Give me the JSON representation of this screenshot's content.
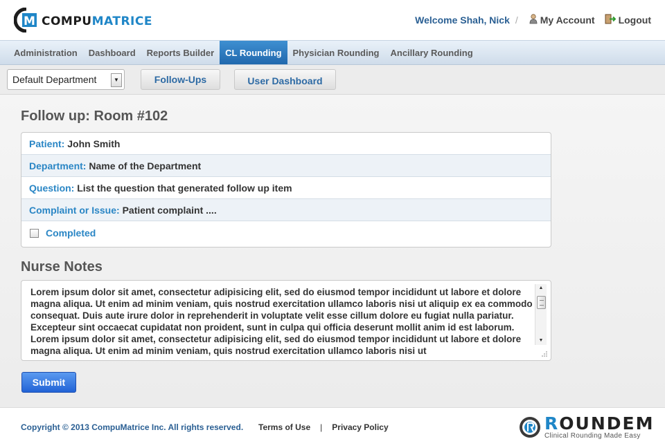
{
  "brand": {
    "name_part1": "COMPU",
    "name_part2": "MATRICE",
    "logo_letter": "M"
  },
  "header": {
    "welcome": "Welcome Shah, Nick",
    "separator": "/",
    "my_account": "My Account",
    "logout": "Logout"
  },
  "nav": {
    "items": [
      {
        "label": "Administration"
      },
      {
        "label": "Dashboard"
      },
      {
        "label": "Reports Builder"
      },
      {
        "label": "CL Rounding",
        "active": true
      },
      {
        "label": "Physician Rounding"
      },
      {
        "label": "Ancillary Rounding"
      }
    ]
  },
  "subbar": {
    "department_select": "Default Department",
    "followups_button": "Follow-Ups",
    "user_dashboard_button": "User Dashboard"
  },
  "followup": {
    "title": "Follow up: Room #102",
    "patient_label": "Patient:",
    "patient_value": "John Smith",
    "department_label": "Department:",
    "department_value": "Name of the Department",
    "question_label": "Question:",
    "question_value": "List the question that generated follow up item",
    "complaint_label": "Complaint or Issue:",
    "complaint_value": "Patient complaint ....",
    "completed_label": "Completed",
    "completed_checked": false
  },
  "notes": {
    "title": "Nurse Notes",
    "text": "Lorem ipsum dolor sit amet, consectetur adipisicing elit, sed do eiusmod tempor incididunt ut labore et dolore magna aliqua. Ut enim ad minim veniam, quis nostrud exercitation ullamco laboris nisi ut aliquip ex ea commodo consequat. Duis aute irure dolor in reprehenderit in voluptate velit esse cillum dolore eu fugiat nulla pariatur. Excepteur sint occaecat cupidatat non proident, sunt in culpa qui officia deserunt mollit anim id est laborum. Lorem ipsum dolor sit amet, consectetur adipisicing elit, sed do eiusmod tempor incididunt ut labore et dolore magna aliqua. Ut enim ad minim veniam, quis nostrud exercitation ullamco laboris nisi ut"
  },
  "submit_label": "Submit",
  "footer": {
    "copyright": "Copyright © 2013 CompuMatrice Inc. All rights reserved.",
    "terms": "Terms of Use",
    "divider": "|",
    "privacy": "Privacy Policy",
    "roundem_word": "ROUNDEM",
    "roundem_tagline": "Clinical Rounding Made Easy"
  },
  "colors": {
    "brand_blue": "#1f86c7",
    "nav_active": "#2a78bf",
    "label_blue": "#2a86c5",
    "submit_blue": "#2f6fe0"
  }
}
